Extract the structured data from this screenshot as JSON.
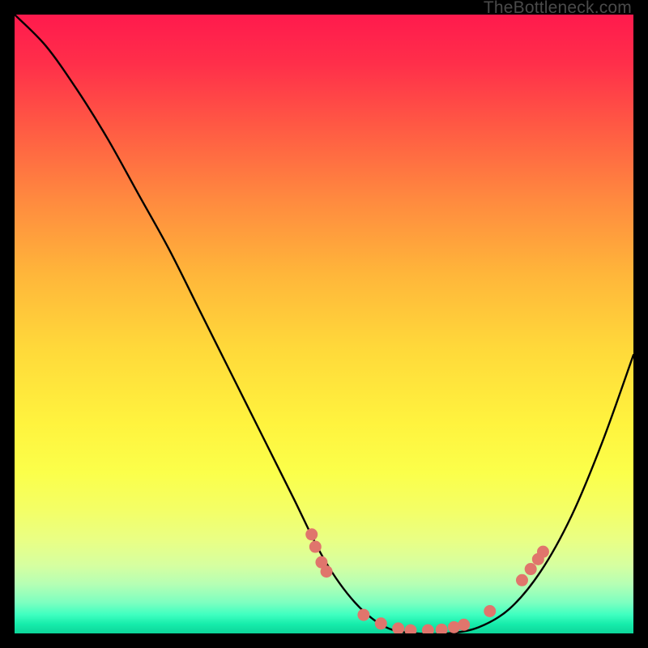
{
  "watermark": "TheBottleneck.com",
  "chart_data": {
    "type": "line",
    "title": "",
    "xlabel": "",
    "ylabel": "",
    "xlim": [
      0,
      1
    ],
    "ylim": [
      0,
      1
    ],
    "series": [
      {
        "name": "curve",
        "x": [
          0.0,
          0.05,
          0.1,
          0.15,
          0.2,
          0.25,
          0.3,
          0.35,
          0.4,
          0.45,
          0.5,
          0.55,
          0.6,
          0.65,
          0.7,
          0.75,
          0.8,
          0.85,
          0.9,
          0.95,
          1.0
        ],
        "y": [
          1.0,
          0.95,
          0.88,
          0.8,
          0.71,
          0.62,
          0.52,
          0.42,
          0.32,
          0.22,
          0.12,
          0.05,
          0.01,
          0.0,
          0.0,
          0.01,
          0.04,
          0.1,
          0.19,
          0.31,
          0.45
        ]
      }
    ],
    "markers": [
      {
        "x": 0.48,
        "y": 0.16
      },
      {
        "x": 0.486,
        "y": 0.14
      },
      {
        "x": 0.496,
        "y": 0.115
      },
      {
        "x": 0.504,
        "y": 0.1
      },
      {
        "x": 0.564,
        "y": 0.03
      },
      {
        "x": 0.592,
        "y": 0.016
      },
      {
        "x": 0.62,
        "y": 0.008
      },
      {
        "x": 0.64,
        "y": 0.005
      },
      {
        "x": 0.668,
        "y": 0.005
      },
      {
        "x": 0.69,
        "y": 0.006
      },
      {
        "x": 0.71,
        "y": 0.01
      },
      {
        "x": 0.726,
        "y": 0.014
      },
      {
        "x": 0.768,
        "y": 0.036
      },
      {
        "x": 0.82,
        "y": 0.086
      },
      {
        "x": 0.834,
        "y": 0.104
      },
      {
        "x": 0.846,
        "y": 0.12
      },
      {
        "x": 0.854,
        "y": 0.132
      }
    ],
    "colors": {
      "curve": "#000000",
      "marker": "#e0756c"
    }
  }
}
